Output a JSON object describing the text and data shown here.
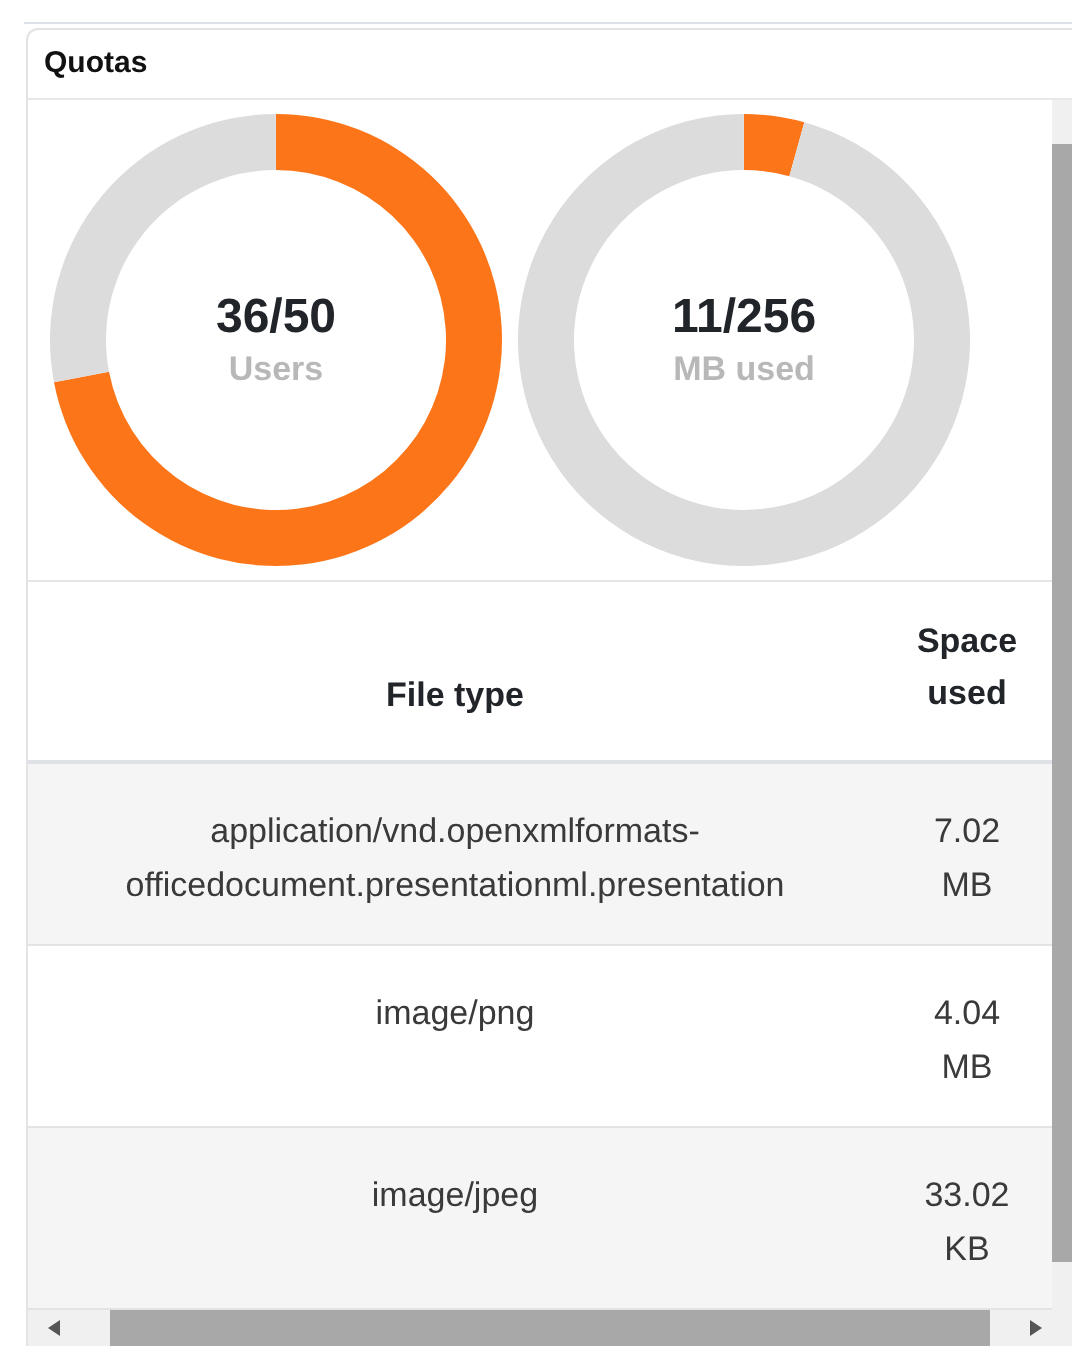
{
  "panel": {
    "title": "Quotas"
  },
  "gauges": [
    {
      "value": "36/50",
      "label": "Users",
      "chart_data": {
        "type": "donut",
        "values": [
          72,
          28
        ]
      }
    },
    {
      "value": "11/256",
      "label": "MB used",
      "chart_data": {
        "type": "donut",
        "values": [
          4.3,
          95.7
        ]
      }
    }
  ],
  "table": {
    "columns": [
      "File type",
      "Space used"
    ],
    "rows": [
      [
        "application/vnd.openxmlformats-officedocument.presentationml.presentation",
        "7.02 MB"
      ],
      [
        "image/png",
        "4.04 MB"
      ],
      [
        "image/jpeg",
        "33.02 KB"
      ]
    ]
  }
}
